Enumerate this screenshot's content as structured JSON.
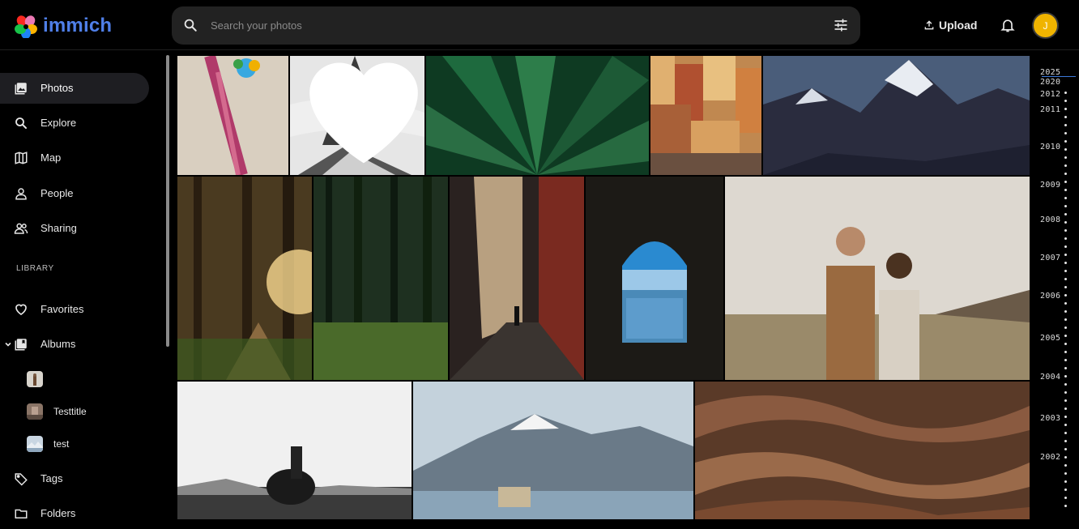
{
  "app": {
    "name": "immich"
  },
  "search": {
    "placeholder": "Search your photos",
    "value": ""
  },
  "header": {
    "upload_label": "Upload",
    "avatar_initial": "J"
  },
  "sidebar": {
    "items": [
      {
        "label": "Photos",
        "icon": "photos-icon",
        "active": true
      },
      {
        "label": "Explore",
        "icon": "search-icon"
      },
      {
        "label": "Map",
        "icon": "map-icon"
      },
      {
        "label": "People",
        "icon": "person-icon"
      },
      {
        "label": "Sharing",
        "icon": "people-icon"
      }
    ],
    "section_label": "LIBRARY",
    "library": [
      {
        "label": "Favorites",
        "icon": "heart-icon"
      },
      {
        "label": "Albums",
        "icon": "album-icon"
      }
    ],
    "albums": [
      {
        "label": ""
      },
      {
        "label": "Testtitle"
      },
      {
        "label": "test"
      }
    ],
    "more": [
      {
        "label": "Tags",
        "icon": "tag-icon"
      },
      {
        "label": "Folders",
        "icon": "folder-icon"
      }
    ]
  },
  "timeline": {
    "years": [
      "2025",
      "2020",
      "2012",
      "2011",
      "2010",
      "2009",
      "2008",
      "2007",
      "2006",
      "2005",
      "2004",
      "2003",
      "2002"
    ]
  },
  "colors": {
    "brand": "#4f7fe8",
    "avatar": "#f0b400",
    "timeline_marker": "#3b78d8"
  }
}
